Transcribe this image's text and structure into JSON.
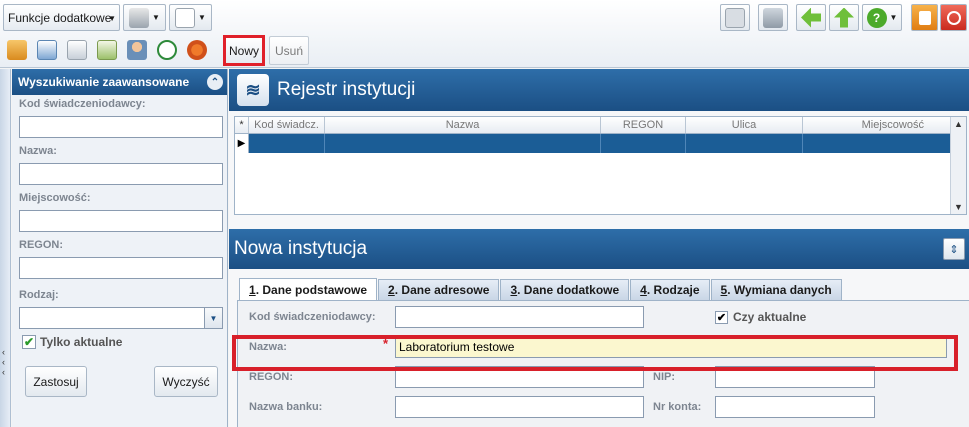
{
  "toolbar": {
    "funkcje_label": "Funkcje dodatkowe",
    "new_label": "Nowy",
    "delete_label": "Usuń",
    "icons": [
      "print-icon",
      "layout-icon",
      "mail-icon",
      "network-icon",
      "back-arrow-icon",
      "up-arrow-icon",
      "help-icon",
      "lock-icon",
      "power-icon",
      "home-icon",
      "calendar-icon",
      "signature-icon",
      "documents-icon",
      "user-icon",
      "clock-icon",
      "flower-icon"
    ]
  },
  "search_panel": {
    "title": "Wyszukiwanie zaawansowane",
    "fields": {
      "kod": "Kod świadczeniodawcy:",
      "nazwa": "Nazwa:",
      "miejscowosc": "Miejscowość:",
      "regon": "REGON:",
      "rodzaj": "Rodzaj:"
    },
    "only_current_label": "Tylko aktualne",
    "only_current_checked": true,
    "apply_label": "Zastosuj",
    "clear_label": "Wyczyść"
  },
  "registry": {
    "title": "Rejestr instytucji",
    "columns": [
      "Kod świadcz.",
      "Nazwa",
      "REGON",
      "Ulica",
      "Miejscowość"
    ],
    "row_marker": "▶"
  },
  "new_institution": {
    "title": "Nowa instytucja",
    "tabs": [
      {
        "num": "1",
        "label": ". Dane podstawowe"
      },
      {
        "num": "2",
        "label": ". Dane adresowe"
      },
      {
        "num": "3",
        "label": ". Dane dodatkowe"
      },
      {
        "num": "4",
        "label": ". Rodzaje"
      },
      {
        "num": "5",
        "label": ". Wymiana danych"
      }
    ],
    "form": {
      "kod_label": "Kod świadczeniodawcy:",
      "kod_value": "",
      "active_label": "Czy aktualne",
      "active_checked": true,
      "nazwa_label": "Nazwa:",
      "nazwa_value": "Laboratorium testowe",
      "required_mark": "*",
      "regon_label": "REGON:",
      "nip_label": "NIP:",
      "bank_label": "Nazwa banku:",
      "account_label": "Nr konta:"
    }
  },
  "colors": {
    "header_blue": "#1b4f84",
    "selected_row": "#1b5d96",
    "highlight_red": "#d8202a",
    "required_field_bg": "#fbf7cf"
  }
}
